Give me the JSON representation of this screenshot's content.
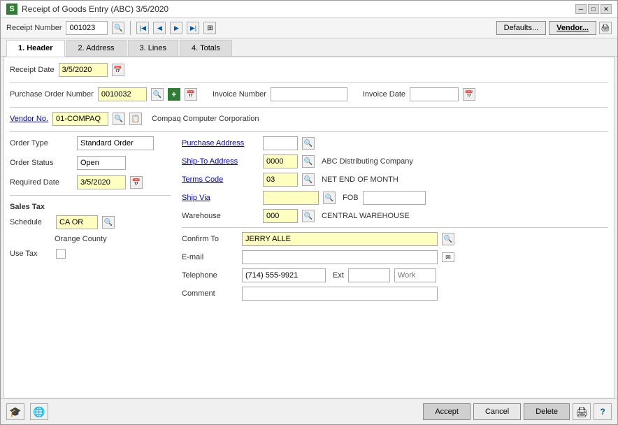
{
  "window": {
    "title": "Receipt of Goods Entry (ABC) 3/5/2020",
    "logo": "S"
  },
  "toolbar": {
    "receipt_number_label": "Receipt Number",
    "receipt_number_value": "001023",
    "defaults_btn": "Defaults...",
    "vendor_btn": "Vendor..."
  },
  "tabs": [
    {
      "label": "1. Header",
      "active": true
    },
    {
      "label": "2. Address",
      "active": false
    },
    {
      "label": "3. Lines",
      "active": false
    },
    {
      "label": "4. Totals",
      "active": false
    }
  ],
  "header": {
    "receipt_date_label": "Receipt Date",
    "receipt_date_value": "3/5/2020",
    "po_number_label": "Purchase Order Number",
    "po_number_value": "0010032",
    "invoice_number_label": "Invoice Number",
    "invoice_number_value": "",
    "invoice_date_label": "Invoice Date",
    "invoice_date_value": "",
    "vendor_no_label": "Vendor No.",
    "vendor_no_value": "01-COMPAQ",
    "vendor_name": "Compaq Computer Corporation",
    "order_type_label": "Order Type",
    "order_type_value": "Standard Order",
    "order_status_label": "Order Status",
    "order_status_value": "Open",
    "required_date_label": "Required Date",
    "required_date_value": "3/5/2020",
    "purchase_address_label": "Purchase Address",
    "purchase_address_value": "",
    "ship_to_address_label": "Ship-To Address",
    "ship_to_address_value": "0000",
    "ship_to_name": "ABC Distributing Company",
    "terms_code_label": "Terms Code",
    "terms_code_value": "03",
    "terms_desc": "NET END OF MONTH",
    "ship_via_label": "Ship Via",
    "ship_via_value": "",
    "fob_label": "FOB",
    "fob_value": "",
    "warehouse_label": "Warehouse",
    "warehouse_value": "000",
    "warehouse_name": "CENTRAL WAREHOUSE",
    "sales_tax_label": "Sales Tax",
    "schedule_label": "Schedule",
    "schedule_value": "CA OR",
    "county_label": "Orange County",
    "use_tax_label": "Use Tax",
    "confirm_to_label": "Confirm To",
    "confirm_to_value": "JERRY ALLE",
    "email_label": "E-mail",
    "email_value": "",
    "telephone_label": "Telephone",
    "telephone_value": "(714) 555-9921",
    "ext_label": "Ext",
    "ext_value": "",
    "work_label": "Work",
    "work_value": "",
    "comment_label": "Comment",
    "comment_value": ""
  },
  "bottom": {
    "accept_btn": "Accept",
    "cancel_btn": "Cancel",
    "delete_btn": "Delete"
  },
  "icons": {
    "search": "🔍",
    "calendar": "📅",
    "nav_first": "⏮",
    "nav_prev": "◀",
    "nav_next": "▶",
    "nav_last": "⏭",
    "printer": "🖨",
    "help": "?",
    "email": "✉",
    "globe": "🌐",
    "hat": "🎓"
  }
}
